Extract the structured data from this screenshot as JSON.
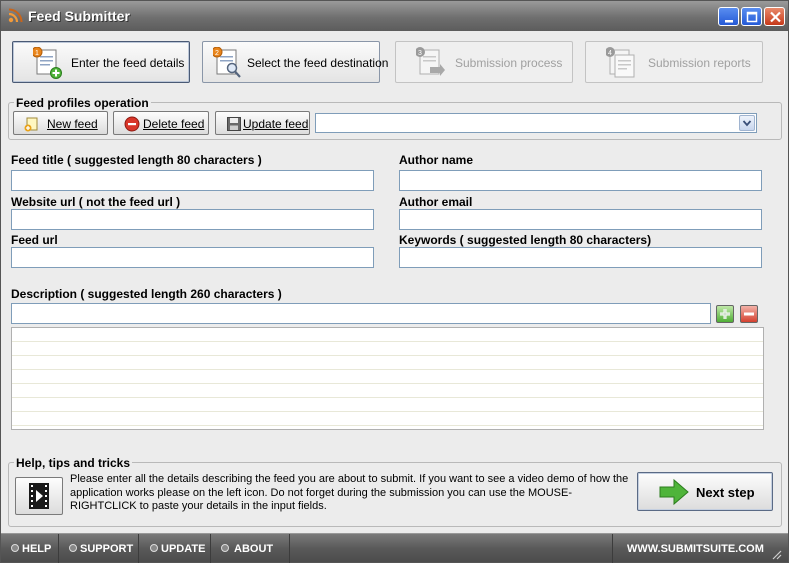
{
  "window": {
    "title": "Feed Submitter",
    "controls": [
      "minimize-icon",
      "maximize-icon",
      "close-icon"
    ]
  },
  "steps": [
    {
      "number": "1",
      "label": "Enter the feed details",
      "state": "active"
    },
    {
      "number": "2",
      "label": "Select the feed destination",
      "state": "enabled"
    },
    {
      "number": "3",
      "label": "Submission process",
      "state": "disabled"
    },
    {
      "number": "4",
      "label": "Submission reports",
      "state": "disabled"
    }
  ],
  "profiles": {
    "title": "Feed profiles operation",
    "new_label": "New feed",
    "delete_label": "Delete feed",
    "update_label": "Update feed",
    "selected_profile": ""
  },
  "form": {
    "feed_title_label": "Feed title ( suggested length 80 characters )",
    "feed_title_value": "",
    "author_name_label": "Author name",
    "author_name_value": "",
    "website_url_label": "Website url ( not the feed url )",
    "website_url_value": "",
    "author_email_label": "Author email",
    "author_email_value": "",
    "feed_url_label": "Feed url",
    "feed_url_value": "",
    "keywords_label": "Keywords ( suggested length 80 characters)",
    "keywords_value": "",
    "description_label": "Description ( suggested length 260 characters )",
    "description_value": ""
  },
  "help": {
    "title": "Help, tips and tricks",
    "text": "Please enter all the details describing the feed you are about to submit. If you want to see a video demo of how the application works please on the left icon. Do not forget during the submission you can use the MOUSE-RIGHTCLICK to paste your details in the input fields.",
    "next_label": "Next step"
  },
  "footer": {
    "items": [
      "HELP",
      "SUPPORT",
      "UPDATE",
      "ABOUT"
    ],
    "site": "WWW.SUBMITSUITE.COM"
  },
  "colors": {
    "accent_orange": "#e8841a",
    "green": "#3fa52c",
    "red": "#cc2a1c"
  }
}
